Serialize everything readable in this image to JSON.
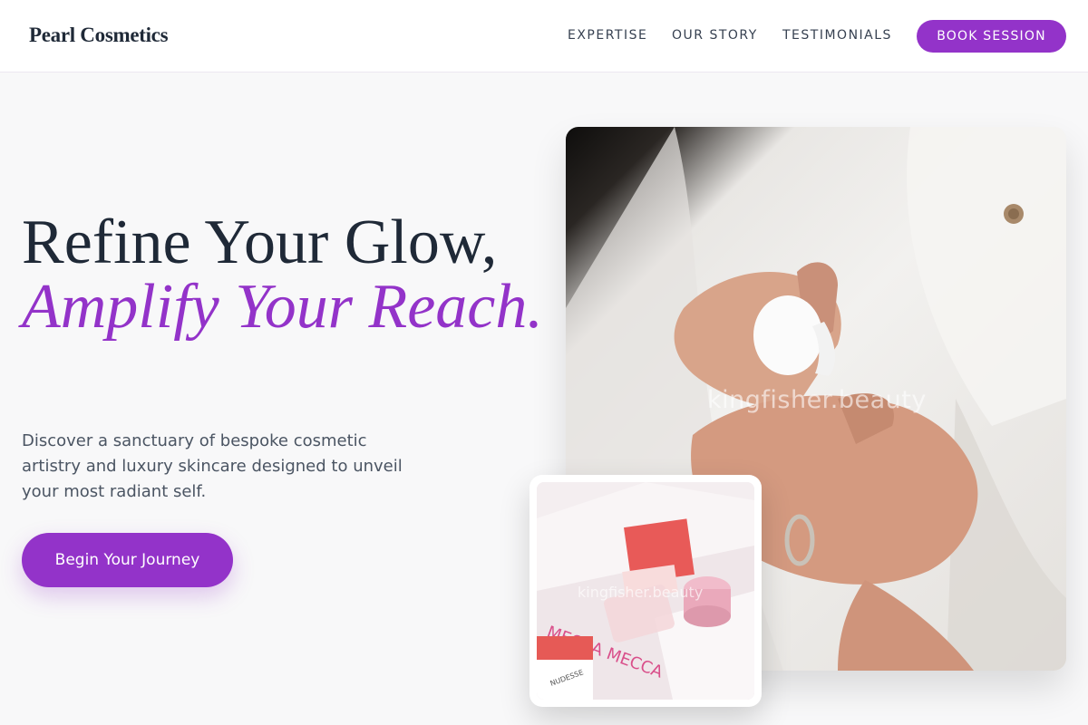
{
  "header": {
    "brand": "Pearl Cosmetics",
    "nav": [
      "EXPERTISE",
      "OUR STORY",
      "TESTIMONIALS"
    ],
    "book_label": "BOOK SESSION"
  },
  "hero": {
    "headline_line1": "Refine Your Glow,",
    "headline_accent": "Amplify Your Reach.",
    "subtext": "Discover a sanctuary of bespoke cosmetic artistry and luxury skincare designed to unveil your most radiant self.",
    "cta_label": "Begin Your Journey"
  },
  "main_image": {
    "watermark": "kingfisher.beauty"
  },
  "thumb_image": {
    "watermark": "kingfisher.beauty",
    "box_text": "MECCA MECCA",
    "jar_label": "NUDESSE"
  },
  "colors": {
    "accent": "#9333c9",
    "heading": "#1f2937",
    "body_text": "#4b5563",
    "page_bg": "#f8f8f9"
  }
}
